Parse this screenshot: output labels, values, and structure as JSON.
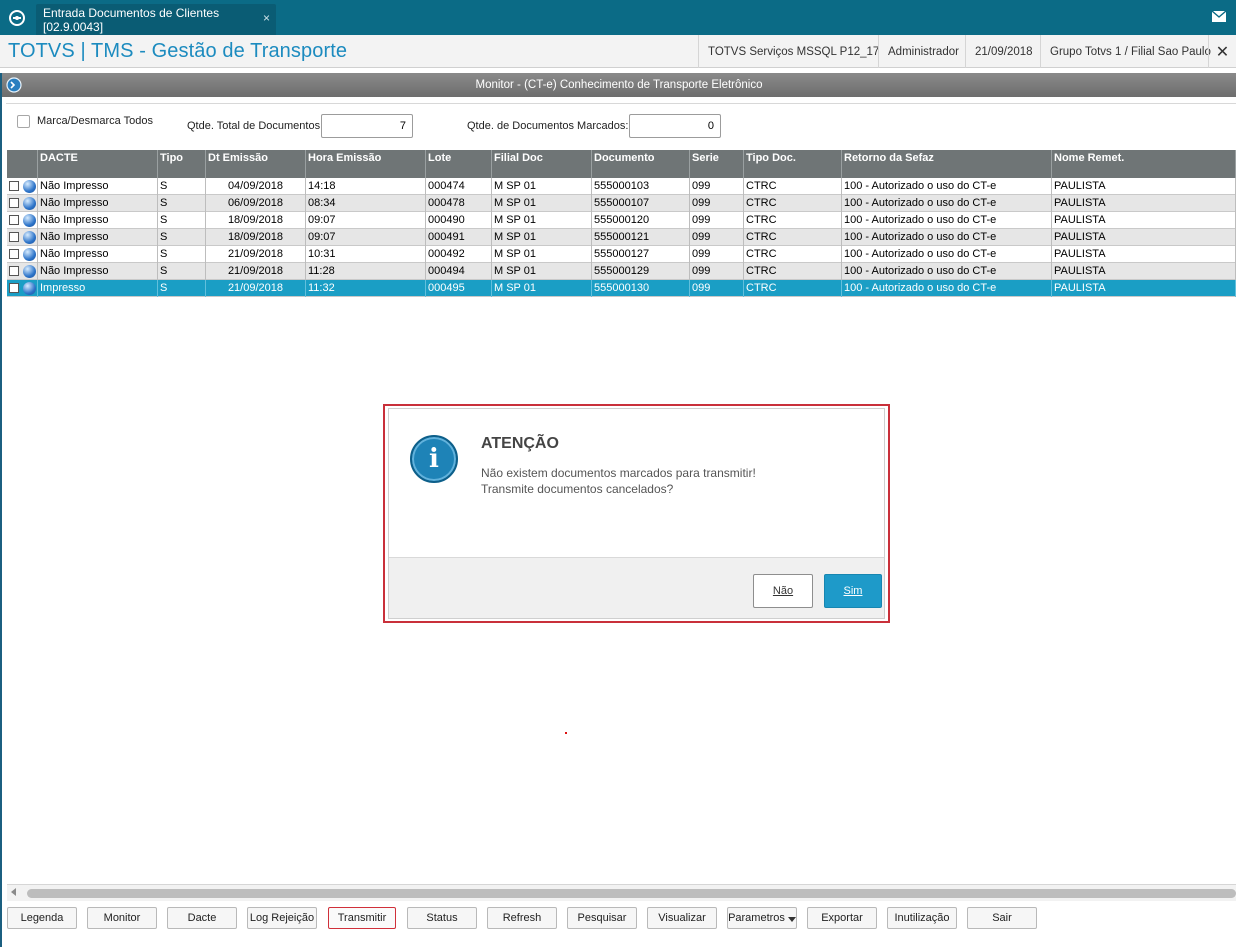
{
  "topbar": {
    "tab_label": "Entrada Documentos de Clientes [02.9.0043]",
    "tab_close": "×"
  },
  "header": {
    "app_title": "TOTVS | TMS - Gestão de Transporte",
    "server": "TOTVS Serviços MSSQL P12_17",
    "user": "Administrador",
    "date": "21/09/2018",
    "branch": "Grupo Totvs 1 / Filial Sao Paulo",
    "close": "✕"
  },
  "window": {
    "title": "Monitor - (CT-e) Conhecimento de Transporte Eletrônico"
  },
  "filters": {
    "mark_all_label": "Marca/Desmarca Todos",
    "total_label": "Qtde. Total de Documentos:",
    "total_value": "7",
    "marked_label": "Qtde. de Documentos Marcados:",
    "marked_value": "0"
  },
  "grid": {
    "columns": [
      "DACTE",
      "Tipo",
      "Dt Emissão",
      "Hora Emissão",
      "Lote",
      "Filial Doc",
      "Documento",
      "Serie",
      "Tipo Doc.",
      "Retorno da Sefaz",
      "Nome Remet."
    ],
    "rows": [
      [
        "Não Impresso",
        "S",
        "04/09/2018",
        "14:18",
        "000474",
        "M SP 01",
        "555000103",
        "099",
        "CTRC",
        "100 - Autorizado o uso do CT-e",
        "PAULISTA"
      ],
      [
        "Não Impresso",
        "S",
        "06/09/2018",
        "08:34",
        "000478",
        "M SP 01",
        "555000107",
        "099",
        "CTRC",
        "100 - Autorizado o uso do CT-e",
        "PAULISTA"
      ],
      [
        "Não Impresso",
        "S",
        "18/09/2018",
        "09:07",
        "000490",
        "M SP 01",
        "555000120",
        "099",
        "CTRC",
        "100 - Autorizado o uso do CT-e",
        "PAULISTA"
      ],
      [
        "Não Impresso",
        "S",
        "18/09/2018",
        "09:07",
        "000491",
        "M SP 01",
        "555000121",
        "099",
        "CTRC",
        "100 - Autorizado o uso do CT-e",
        "PAULISTA"
      ],
      [
        "Não Impresso",
        "S",
        "21/09/2018",
        "10:31",
        "000492",
        "M SP 01",
        "555000127",
        "099",
        "CTRC",
        "100 - Autorizado o uso do CT-e",
        "PAULISTA"
      ],
      [
        "Não Impresso",
        "S",
        "21/09/2018",
        "11:28",
        "000494",
        "M SP 01",
        "555000129",
        "099",
        "CTRC",
        "100 - Autorizado o uso do CT-e",
        "PAULISTA"
      ],
      [
        "Impresso",
        "S",
        "21/09/2018",
        "11:32",
        "000495",
        "M SP 01",
        "555000130",
        "099",
        "CTRC",
        "100 - Autorizado o uso do CT-e",
        "PAULISTA"
      ]
    ],
    "selected_row": 6
  },
  "dialog": {
    "title": "ATENÇÃO",
    "line1": "Não existem documentos marcados para transmitir!",
    "line2": "Transmite documentos cancelados?",
    "no_label": "Não",
    "yes_label": "Sim",
    "icon_glyph": "i"
  },
  "toolbar": {
    "buttons": [
      "Legenda",
      "Monitor",
      "Dacte",
      "Log Rejeição",
      "Transmitir",
      "Status",
      "Refresh",
      "Pesquisar",
      "Visualizar",
      "Parametros",
      "Exportar",
      "Inutilização",
      "Sair"
    ]
  },
  "colors": {
    "topbar": "#0b6b86",
    "accent": "#1c8bbf",
    "selection": "#1a9ec5",
    "highlight_border": "#c9303a"
  }
}
